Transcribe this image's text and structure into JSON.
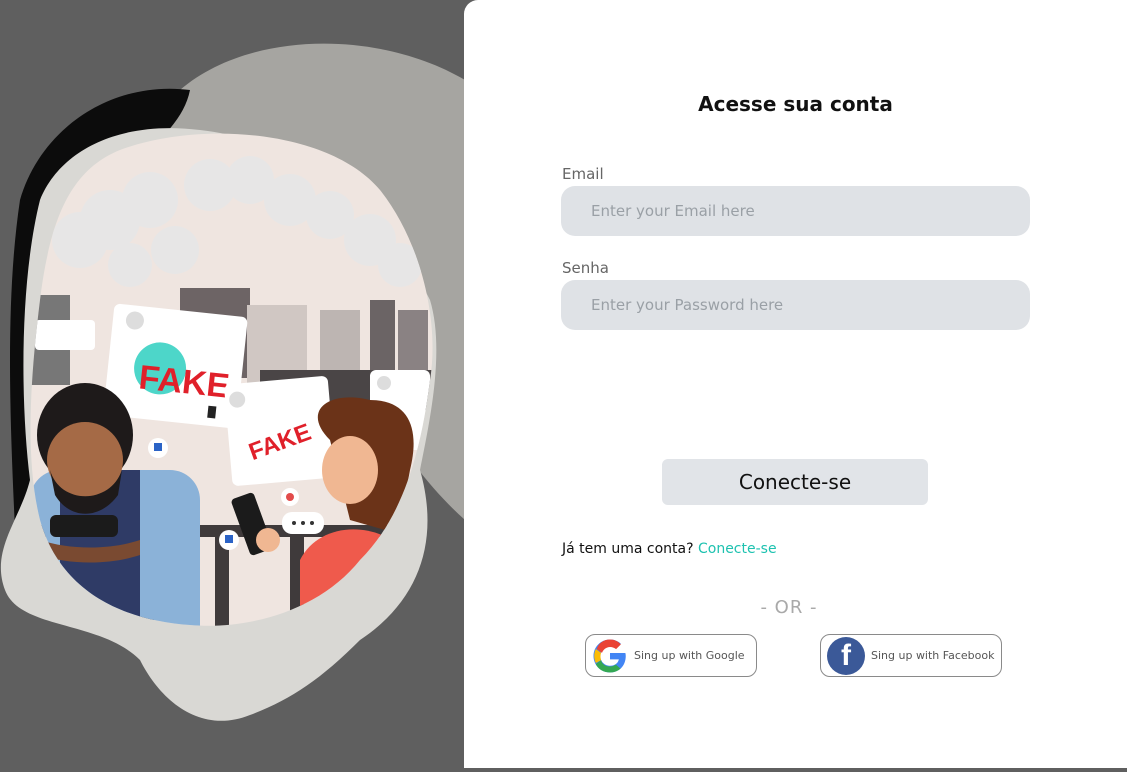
{
  "login": {
    "title": "Acesse sua conta",
    "email_label": "Email",
    "email_placeholder": "Enter your Email here",
    "password_label": "Senha",
    "password_placeholder": "Enter your Password here",
    "submit_label": "Conecte-se",
    "account_prompt": "Já tem uma conta?",
    "account_link": "Conecte-se",
    "or_text": "- OR -",
    "google_label": "Sing up with Google",
    "facebook_label": "Sing up with Facebook"
  },
  "illustration": {
    "fake_word": "FAKE"
  },
  "colors": {
    "left_background": "#5f5f5f",
    "input_background": "#dfe2e6",
    "link": "#1ec2b0",
    "facebook": "#3b5998"
  },
  "icons": [
    "google-logo-icon",
    "facebook-logo-icon",
    "thumbs-down-icon",
    "heart-icon",
    "bookmark-icon"
  ]
}
